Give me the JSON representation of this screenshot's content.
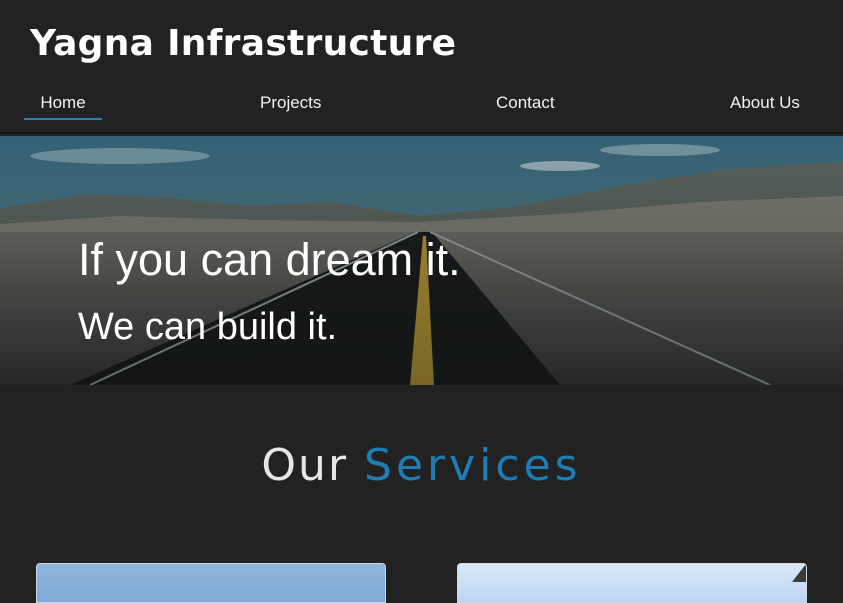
{
  "header": {
    "brand": "Yagna Infrastructure",
    "nav": [
      {
        "label": "Home",
        "active": true
      },
      {
        "label": "Projects",
        "active": false
      },
      {
        "label": "Contact",
        "active": false
      },
      {
        "label": "About Us",
        "active": false
      }
    ]
  },
  "hero": {
    "line1": "If you can dream it.",
    "line2": "We can build it."
  },
  "services": {
    "title_part1": "Our",
    "title_part2": "Services"
  },
  "colors": {
    "background": "#222222",
    "accent": "#2185c2",
    "text": "#ffffff"
  }
}
